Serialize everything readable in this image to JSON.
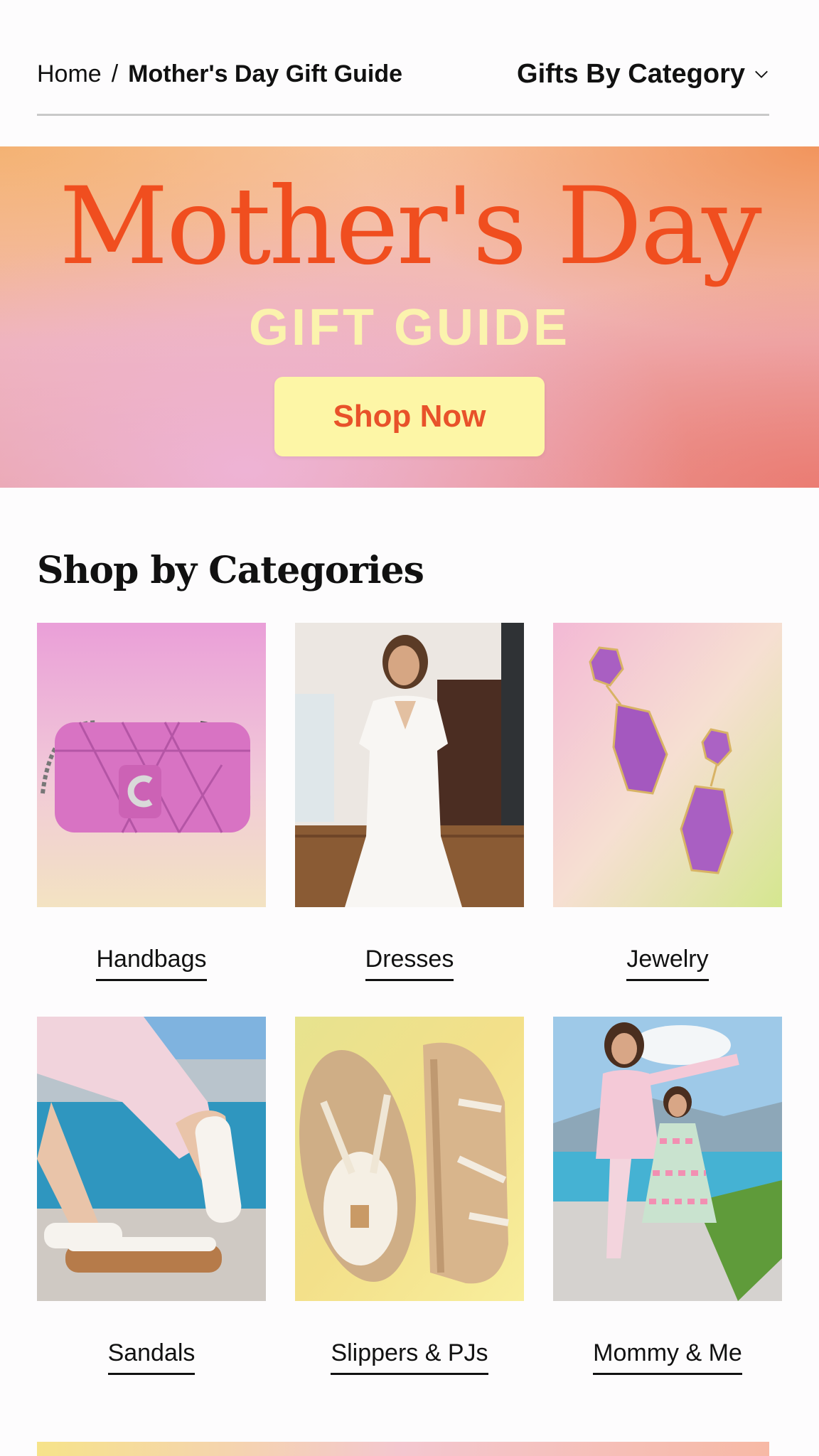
{
  "breadcrumb": {
    "home": "Home",
    "separator": "/",
    "current": "Mother's Day Gift Guide"
  },
  "category_menu": {
    "label": "Gifts By Category",
    "icon": "chevron-down-icon"
  },
  "hero": {
    "title": "Mother's Day",
    "subtitle": "GIFT GUIDE",
    "cta_label": "Shop Now"
  },
  "section": {
    "title": "Shop by Categories"
  },
  "categories": [
    {
      "label": "Handbags"
    },
    {
      "label": "Dresses"
    },
    {
      "label": "Jewelry"
    },
    {
      "label": "Sandals"
    },
    {
      "label": "Slippers & PJs"
    },
    {
      "label": "Mommy & Me"
    }
  ],
  "colors": {
    "hero_title": "#f04e1f",
    "hero_subtitle": "#fbf3ad",
    "cta_background": "#fdf6a6",
    "cta_text": "#e8522a"
  }
}
